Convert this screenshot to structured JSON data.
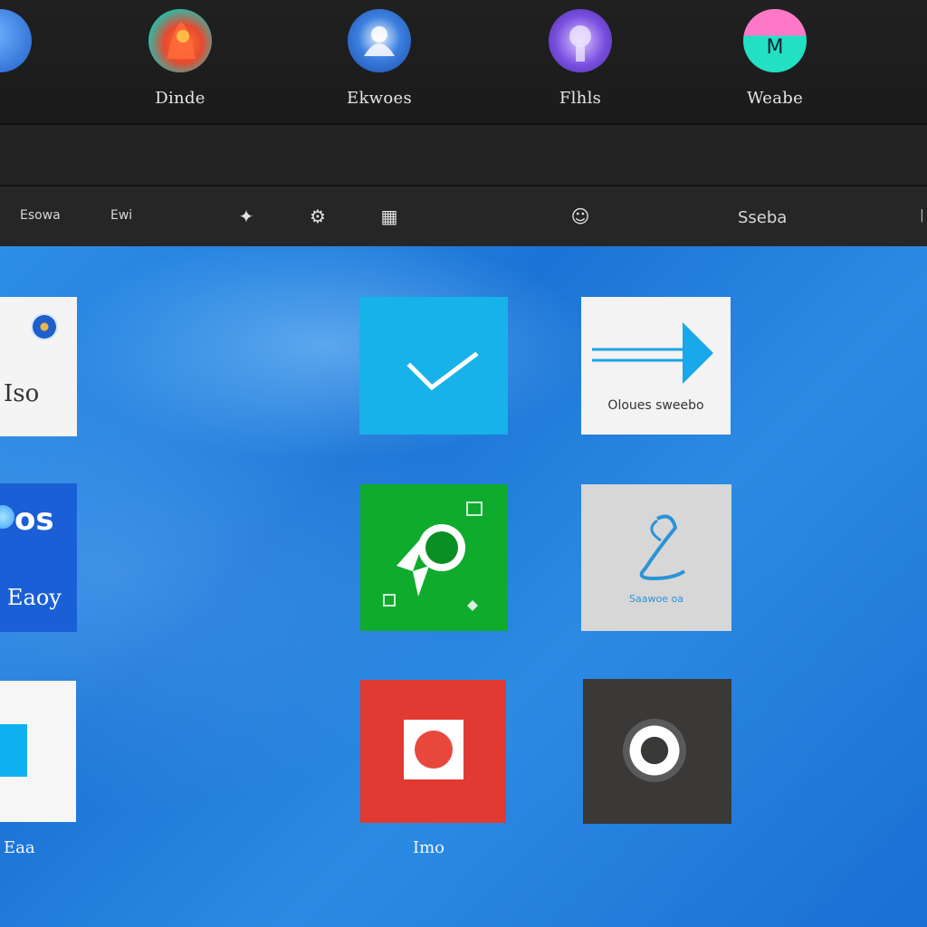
{
  "profiles": [
    {
      "label": "",
      "icon": "blue-avatar"
    },
    {
      "label": "Dinde",
      "icon": "orange-avatar"
    },
    {
      "label": "Ekwoes",
      "icon": "blue-avatar"
    },
    {
      "label": "Flhls",
      "icon": "purple-avatar"
    },
    {
      "label": "Weabe",
      "icon": "pink-avatar"
    }
  ],
  "toolbar": {
    "left_text": "Esowa",
    "left_text_2": "Ewi",
    "right_text": "Sseba"
  },
  "tiles": {
    "tile_a": {
      "text": "Iso",
      "color": "#f4f4f4"
    },
    "tile_check": {
      "color": "#18b2ea",
      "icon": "checkmark-icon"
    },
    "tile_arrow": {
      "text": "Oloues sweebo",
      "color": "#f3f3f3"
    },
    "tile_os": {
      "title": "os",
      "subtitle": "Eaoy",
      "color": "#1a5fd6"
    },
    "tile_green": {
      "color": "#0fab2d",
      "icon": "globe-icon"
    },
    "tile_gray": {
      "text": "Saawoe oa",
      "color": "#d7d7d8"
    },
    "tile_white": {
      "color": "#f6f6f6"
    },
    "tile_red": {
      "color": "#e03a32"
    },
    "tile_dark": {
      "color": "#3a3938"
    }
  },
  "captions": {
    "left_bottom": "Eaa",
    "mid_bottom": "Imo"
  },
  "colors": {
    "desktop_blue": "#2680e0",
    "bar_bg": "#1f1f20"
  }
}
